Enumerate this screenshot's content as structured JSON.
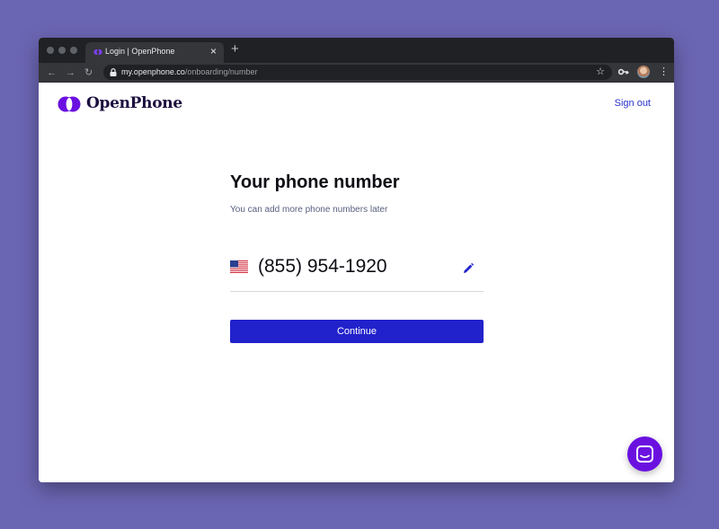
{
  "browser": {
    "tab_title": "Login | OpenPhone",
    "tab_close": "×",
    "new_tab": "+",
    "url_host": "my.openphone.co",
    "url_path": "/onboarding/number",
    "back": "←",
    "forward": "→",
    "reload": "↻",
    "star": "☆",
    "menu": "⋮"
  },
  "header": {
    "brand_name": "OpenPhone",
    "sign_out_label": "Sign out"
  },
  "main": {
    "title": "Your phone number",
    "subtitle": "You can add more phone numbers later",
    "phone_number": "(855) 954-1920",
    "country_flag": "us-flag-icon",
    "continue_label": "Continue"
  },
  "colors": {
    "background": "#6b66b3",
    "primary_button": "#2222cc",
    "link": "#2a31c9",
    "brand_purple": "#6a11e0",
    "brand_text": "#1c0f3f"
  }
}
